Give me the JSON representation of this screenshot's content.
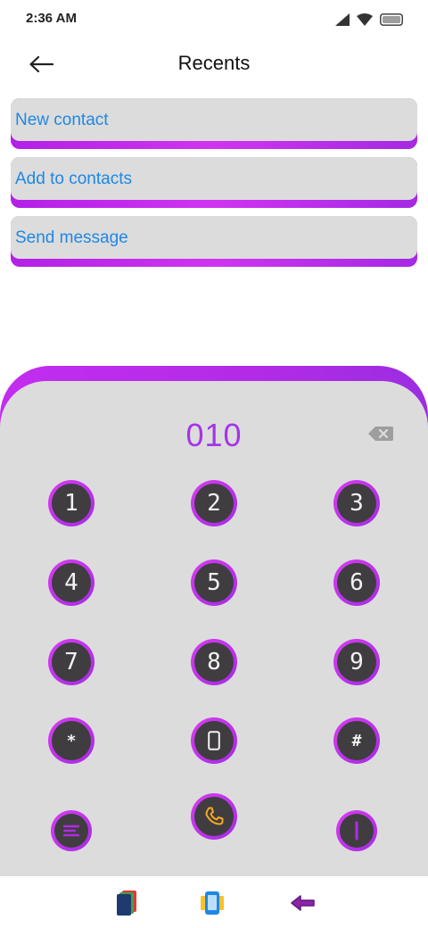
{
  "status_bar": {
    "time": "2:36 AM"
  },
  "header": {
    "title": "Recents"
  },
  "actions": [
    {
      "label": "New contact"
    },
    {
      "label": "Add to contacts"
    },
    {
      "label": "Send message"
    }
  ],
  "dialer": {
    "number": "010",
    "keys": [
      "1",
      "2",
      "3",
      "4",
      "5",
      "6",
      "7",
      "8",
      "9",
      "*",
      "0",
      "#"
    ]
  },
  "colors": {
    "accent_purple": "#b32ae6",
    "card_face": "#dcdcdc",
    "link_blue": "#1e88e5",
    "key_face": "#3f3d3f",
    "call_orange": "#f5a623"
  },
  "icons": {
    "back": "arrow-left-icon",
    "backspace": "backspace-icon",
    "call": "phone-icon",
    "menu": "menu-icon",
    "power": "power-icon",
    "nav_left": "layers-icon",
    "nav_center": "device-icon",
    "nav_right": "back-arrow-icon"
  }
}
